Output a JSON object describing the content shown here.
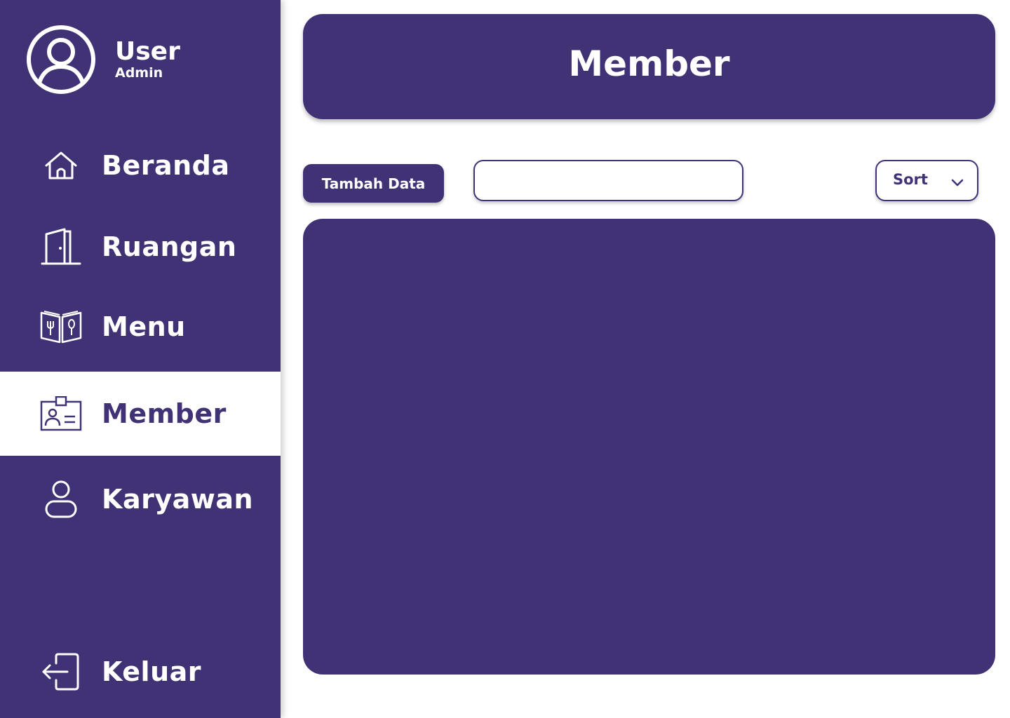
{
  "user": {
    "name": "User",
    "role": "Admin",
    "icon": "user-circle-icon"
  },
  "nav": [
    {
      "label": "Beranda",
      "icon": "home-icon",
      "active": false
    },
    {
      "label": "Ruangan",
      "icon": "door-icon",
      "active": false
    },
    {
      "label": "Menu",
      "icon": "menu-book-icon",
      "active": false
    },
    {
      "label": "Member",
      "icon": "id-card-icon",
      "active": true
    },
    {
      "label": "Karyawan",
      "icon": "person-icon",
      "active": false
    },
    {
      "label": "Keluar",
      "icon": "logout-icon",
      "active": false
    }
  ],
  "header": {
    "title": "Member"
  },
  "toolbar": {
    "add_label": "Tambah Data",
    "search_value": "",
    "sort_label": "Sort",
    "sort_icon": "chevron-down-icon"
  },
  "colors": {
    "primary": "#413275",
    "background": "#ffffff",
    "text_on_primary": "#ffffff"
  }
}
